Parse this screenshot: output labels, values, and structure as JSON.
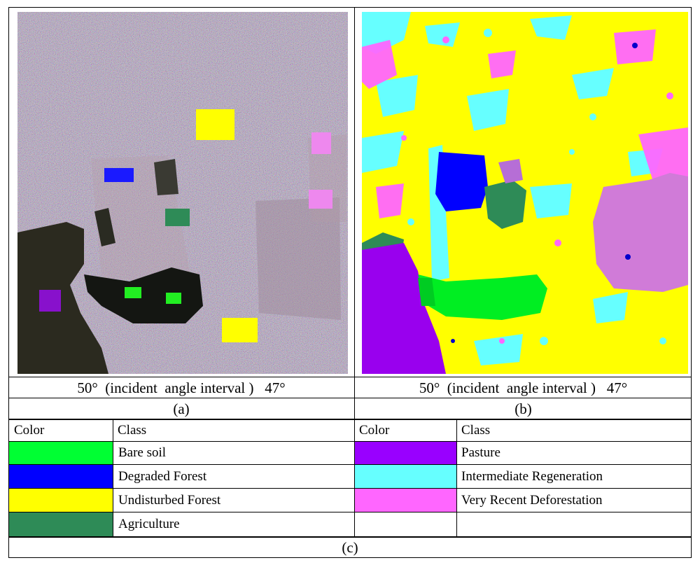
{
  "panels": {
    "a": {
      "angle_caption": "50°  (incident  angle interval )   47°",
      "label": "(a)"
    },
    "b": {
      "angle_caption": "50°  (incident  angle interval )   47°",
      "label": "(b)"
    }
  },
  "legend": {
    "label": "(c)",
    "headers": {
      "color": "Color",
      "class": "Class"
    },
    "left": [
      {
        "name": "Bare soil",
        "color": "#00ff33"
      },
      {
        "name": "Degraded Forest",
        "color": "#0000ff"
      },
      {
        "name": "Undisturbed Forest",
        "color": "#ffff00"
      },
      {
        "name": "Agriculture",
        "color": "#2e8b57"
      }
    ],
    "right": [
      {
        "name": "Pasture",
        "color": "#9900ff"
      },
      {
        "name": "Intermediate Regeneration",
        "color": "#66ffff"
      },
      {
        "name": "Very Recent Deforestation",
        "color": "#ff66ff"
      }
    ]
  }
}
